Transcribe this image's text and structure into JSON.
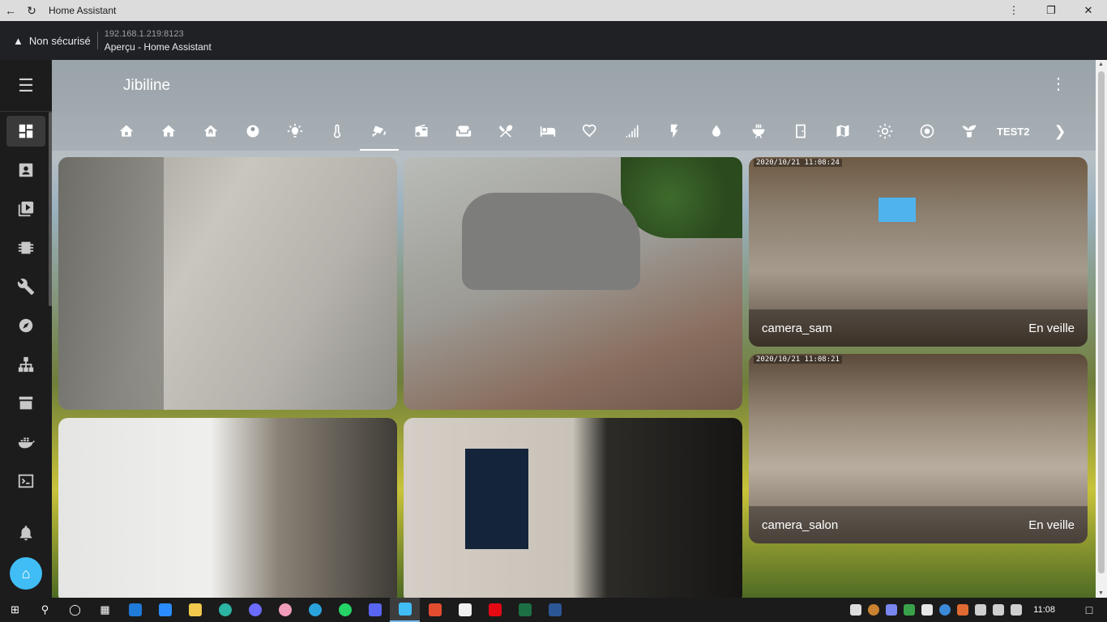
{
  "browser": {
    "window_title": "Home Assistant",
    "security_text": "Non sécurisé",
    "url": "192.168.1.219:8123",
    "page_title": "Aperçu - Home Assistant"
  },
  "header": {
    "title": "Jibiline"
  },
  "tabs": {
    "icons": [
      "home-outline-icon",
      "home-icon",
      "home-floor-icon",
      "robot-vacuum-icon",
      "lightbulb-icon",
      "thermometer-icon",
      "cctv-icon",
      "radio-icon",
      "sofa-icon",
      "silverware-icon",
      "bed-icon",
      "heart-icon",
      "signal-icon",
      "flash-icon",
      "water-icon",
      "grill-icon",
      "door-icon",
      "map-icon",
      "sun-icon",
      "speaker-icon",
      "sprout-icon"
    ],
    "active_index": 6,
    "text_tab": "TEST2"
  },
  "cameras": {
    "sam": {
      "timestamp": "2020/10/21  11:08:24",
      "name": "camera_sam",
      "state": "En veille"
    },
    "salon": {
      "timestamp": "2020/10/21  11:08:21",
      "name": "camera_salon",
      "state": "En veille"
    }
  },
  "taskbar": {
    "clock": "11:08"
  },
  "colors": {
    "sidebar": "#1c1c1c",
    "accent": "#41bdf5",
    "header_overlay": "#96a0a6"
  }
}
